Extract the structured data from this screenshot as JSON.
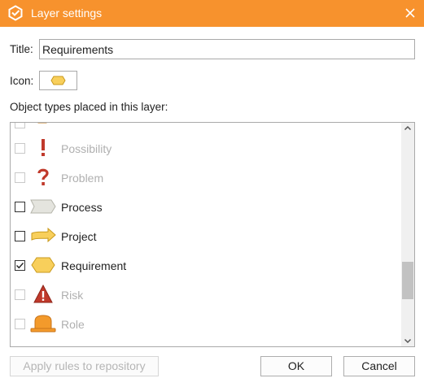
{
  "window": {
    "title": "Layer settings",
    "accent_color": "#f7922d"
  },
  "form": {
    "title_label": "Title:",
    "title_value": "Requirements",
    "icon_label": "Icon:",
    "icon_value": "requirement-hexagon-icon",
    "list_label": "Object types placed in this layer:"
  },
  "object_types": [
    {
      "name": "",
      "icon": "partial-orange-icon",
      "checked": false,
      "enabled": false
    },
    {
      "name": "Possibility",
      "icon": "exclamation-icon",
      "checked": false,
      "enabled": false
    },
    {
      "name": "Problem",
      "icon": "question-mark-icon",
      "checked": false,
      "enabled": false
    },
    {
      "name": "Process",
      "icon": "process-chevron-icon",
      "checked": false,
      "enabled": true
    },
    {
      "name": "Project",
      "icon": "project-arrow-icon",
      "checked": false,
      "enabled": true
    },
    {
      "name": "Requirement",
      "icon": "requirement-hexagon-icon",
      "checked": true,
      "enabled": true
    },
    {
      "name": "Risk",
      "icon": "risk-warning-icon",
      "checked": false,
      "enabled": false
    },
    {
      "name": "Role",
      "icon": "role-hat-icon",
      "checked": false,
      "enabled": false
    },
    {
      "name": "",
      "icon": "partial-gray-icon",
      "checked": false,
      "enabled": false
    }
  ],
  "buttons": {
    "apply_rules": "Apply rules to repository",
    "ok": "OK",
    "cancel": "Cancel"
  }
}
